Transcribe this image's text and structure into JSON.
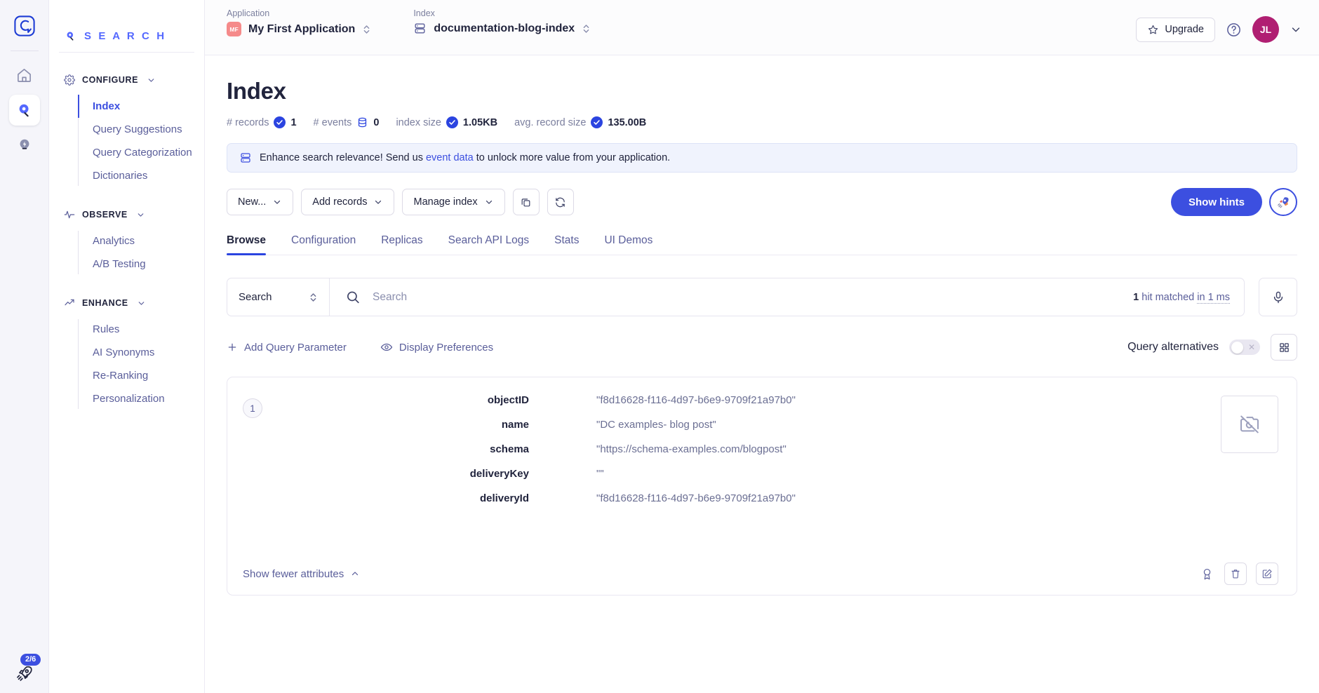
{
  "rail": {
    "logo_icon": "algolia-logo-icon",
    "items": [
      {
        "name": "home-icon",
        "label": "Home"
      },
      {
        "name": "search-icon",
        "label": "Search",
        "active": true
      },
      {
        "name": "lightning-icon",
        "label": "Events"
      }
    ],
    "onboarding_badge": "2/6",
    "onboarding_icon": "rocket-icon"
  },
  "sidebar": {
    "brand": "S E A R C H",
    "groups": [
      {
        "title": "CONFIGURE",
        "icon": "gear-icon",
        "items": [
          {
            "label": "Index",
            "active": true
          },
          {
            "label": "Query Suggestions",
            "active": false
          },
          {
            "label": "Query Categorization",
            "active": false
          },
          {
            "label": "Dictionaries",
            "active": false
          }
        ]
      },
      {
        "title": "OBSERVE",
        "icon": "pulse-icon",
        "items": [
          {
            "label": "Analytics",
            "active": false
          },
          {
            "label": "A/B Testing",
            "active": false
          }
        ]
      },
      {
        "title": "ENHANCE",
        "icon": "trending-up-icon",
        "items": [
          {
            "label": "Rules",
            "active": false
          },
          {
            "label": "AI Synonyms",
            "active": false
          },
          {
            "label": "Re-Ranking",
            "active": false
          },
          {
            "label": "Personalization",
            "active": false
          }
        ]
      }
    ]
  },
  "topbar": {
    "application_label": "Application",
    "application_value": "My First Application",
    "application_initials": "MF",
    "index_label": "Index",
    "index_value": "documentation-blog-index",
    "upgrade_label": "Upgrade",
    "help_icon": "question-circle-icon",
    "avatar_initials": "JL"
  },
  "page": {
    "title": "Index",
    "stats": [
      {
        "label": "# records",
        "value": "1",
        "icon": "check-circle-icon"
      },
      {
        "label": "# events",
        "value": "0",
        "icon": "database-icon"
      },
      {
        "label": "index size",
        "value": "1.05KB",
        "icon": "check-circle-icon"
      },
      {
        "label": "avg. record size",
        "value": "135.00B",
        "icon": "check-circle-icon"
      }
    ],
    "banner": {
      "icon": "database-icon",
      "text_before": "Enhance search relevance! Send us ",
      "link": "event data",
      "text_after": " to unlock more value from your application."
    },
    "toolbar": {
      "new_label": "New...",
      "add_records_label": "Add records",
      "manage_index_label": "Manage index",
      "copy_icon": "copy-icon",
      "refresh_icon": "refresh-icon",
      "hints_label": "Show hints",
      "rocket_icon": "rocket-icon"
    },
    "tabs": [
      {
        "label": "Browse",
        "active": true
      },
      {
        "label": "Configuration",
        "active": false
      },
      {
        "label": "Replicas",
        "active": false
      },
      {
        "label": "Search API Logs",
        "active": false
      },
      {
        "label": "Stats",
        "active": false
      },
      {
        "label": "UI Demos",
        "active": false
      }
    ],
    "search": {
      "mode_value": "Search",
      "placeholder": "Search",
      "input_value": "",
      "hits_count": "1",
      "hits_text": " hit matched ",
      "hits_time": "in 1 ms",
      "mic_icon": "microphone-icon"
    },
    "options": {
      "add_query_parameter": "Add Query Parameter",
      "display_preferences": "Display Preferences",
      "query_alternatives_label": "Query alternatives",
      "query_alternatives_on": false,
      "grid_icon": "grid-view-icon"
    },
    "record": {
      "rank": "1",
      "attributes": [
        {
          "key": "objectID",
          "value": "\"f8d16628-f116-4d97-b6e9-9709f21a97b0\""
        },
        {
          "key": "name",
          "value": "\"DC examples- blog post\""
        },
        {
          "key": "schema",
          "value": "\"https://schema-examples.com/blogpost\""
        },
        {
          "key": "deliveryKey",
          "value": "\"\""
        },
        {
          "key": "deliveryId",
          "value": "\"f8d16628-f116-4d97-b6e9-9709f21a97b0\""
        }
      ],
      "thumbnail_icon": "no-image-icon",
      "show_fewer_label": "Show fewer attributes",
      "actions": [
        {
          "name": "promote-record-icon"
        },
        {
          "name": "delete-record-icon"
        },
        {
          "name": "edit-record-icon"
        }
      ]
    }
  }
}
